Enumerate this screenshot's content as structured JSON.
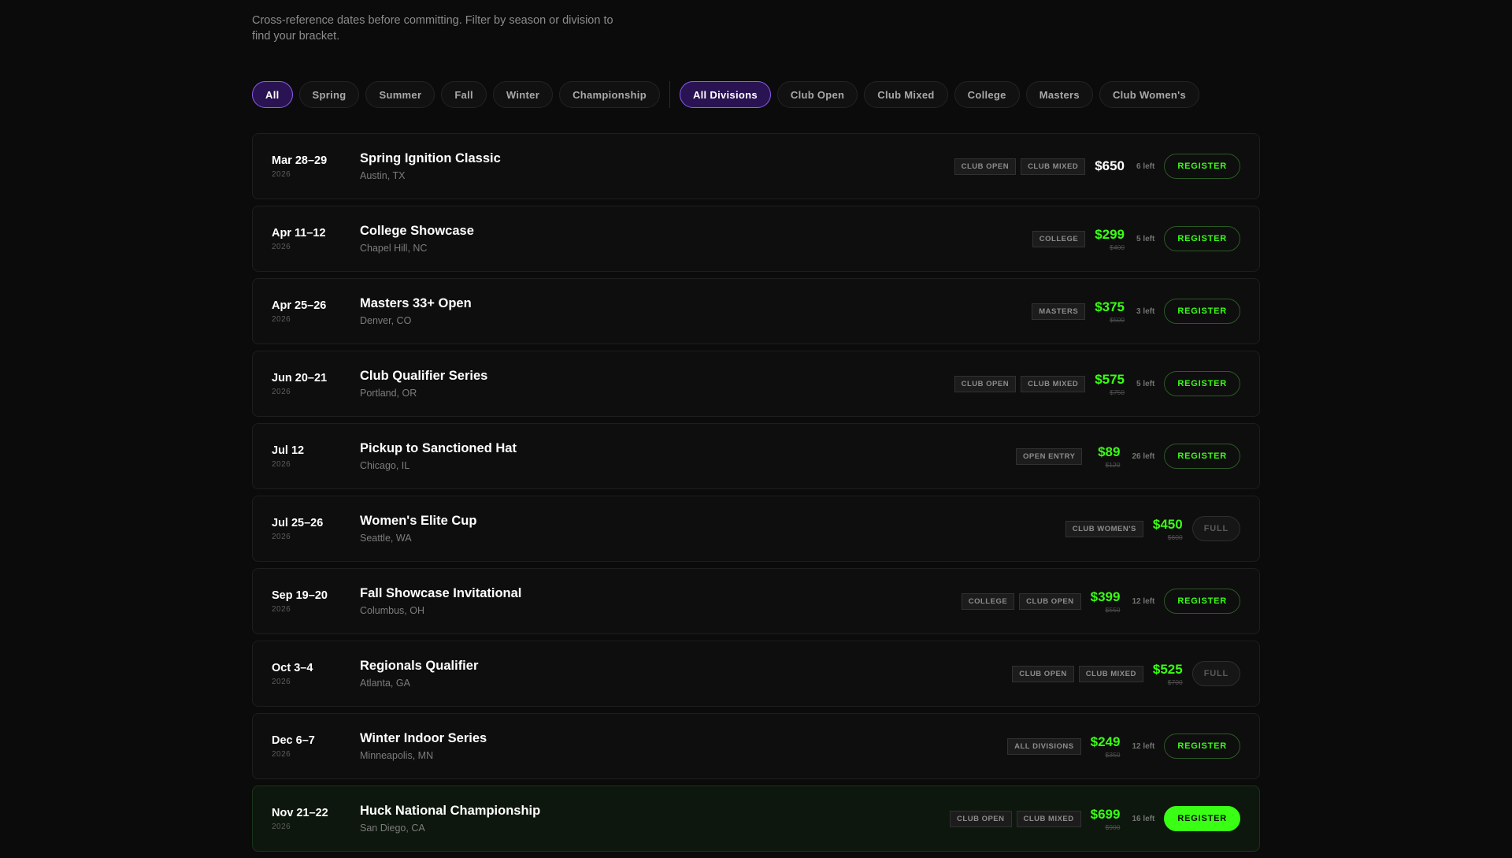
{
  "intro": {
    "line1": "Cross-reference dates before committing. Filter by season or division to",
    "line2": "find your bracket."
  },
  "filters": {
    "seasons": [
      "All",
      "Spring",
      "Summer",
      "Fall",
      "Winter",
      "Championship"
    ],
    "divisions": [
      "All Divisions",
      "Club Open",
      "Club Mixed",
      "College",
      "Masters",
      "Club Women's"
    ],
    "active_season": "All",
    "active_division": "All Divisions"
  },
  "colors": {
    "accent_green": "#39ff14",
    "accent_purple": "#8b5cf6",
    "background": "#0b0b0b"
  },
  "events": [
    {
      "date": "Mar 28–29",
      "year": "2026",
      "name": "Spring Ignition Classic",
      "location": "Austin, TX",
      "tags": [
        "CLUB OPEN",
        "CLUB MIXED"
      ],
      "price": "$650",
      "was": "",
      "spots": "6 left",
      "action": "REGISTER",
      "status": "open"
    },
    {
      "date": "Apr 11–12",
      "year": "2026",
      "name": "College Showcase",
      "location": "Chapel Hill, NC",
      "tags": [
        "COLLEGE"
      ],
      "price": "$299",
      "was": "$400",
      "spots": "5 left",
      "action": "REGISTER",
      "status": "open"
    },
    {
      "date": "Apr 25–26",
      "year": "2026",
      "name": "Masters 33+ Open",
      "location": "Denver, CO",
      "tags": [
        "MASTERS"
      ],
      "price": "$375",
      "was": "$500",
      "spots": "3 left",
      "action": "REGISTER",
      "status": "open"
    },
    {
      "date": "Jun 20–21",
      "year": "2026",
      "name": "Club Qualifier Series",
      "location": "Portland, OR",
      "tags": [
        "CLUB OPEN",
        "CLUB MIXED"
      ],
      "price": "$575",
      "was": "$750",
      "spots": "5 left",
      "action": "REGISTER",
      "status": "open"
    },
    {
      "date": "Jul 12",
      "year": "2026",
      "name": "Pickup to Sanctioned Hat",
      "location": "Chicago, IL",
      "tags": [
        "OPEN ENTRY"
      ],
      "price": "$89",
      "was": "$120",
      "spots": "26 left",
      "action": "REGISTER",
      "status": "open"
    },
    {
      "date": "Jul 25–26",
      "year": "2026",
      "name": "Women's Elite Cup",
      "location": "Seattle, WA",
      "tags": [
        "CLUB WOMEN'S"
      ],
      "price": "$450",
      "was": "$600",
      "spots": "",
      "action": "FULL",
      "status": "full"
    },
    {
      "date": "Sep 19–20",
      "year": "2026",
      "name": "Fall Showcase Invitational",
      "location": "Columbus, OH",
      "tags": [
        "COLLEGE",
        "CLUB OPEN"
      ],
      "price": "$399",
      "was": "$550",
      "spots": "12 left",
      "action": "REGISTER",
      "status": "open"
    },
    {
      "date": "Oct 3–4",
      "year": "2026",
      "name": "Regionals Qualifier",
      "location": "Atlanta, GA",
      "tags": [
        "CLUB OPEN",
        "CLUB MIXED"
      ],
      "price": "$525",
      "was": "$700",
      "spots": "",
      "action": "FULL",
      "status": "full"
    },
    {
      "date": "Dec 6–7",
      "year": "2026",
      "name": "Winter Indoor Series",
      "location": "Minneapolis, MN",
      "tags": [
        "ALL DIVISIONS"
      ],
      "price": "$249",
      "was": "$350",
      "spots": "12 left",
      "action": "REGISTER",
      "status": "open"
    },
    {
      "date": "Nov 21–22",
      "year": "2026",
      "name": "Huck National Championship",
      "location": "San Diego, CA",
      "tags": [
        "CLUB OPEN",
        "CLUB MIXED"
      ],
      "price": "$699",
      "was": "$900",
      "spots": "16 left",
      "action": "REGISTER",
      "status": "featured"
    }
  ]
}
